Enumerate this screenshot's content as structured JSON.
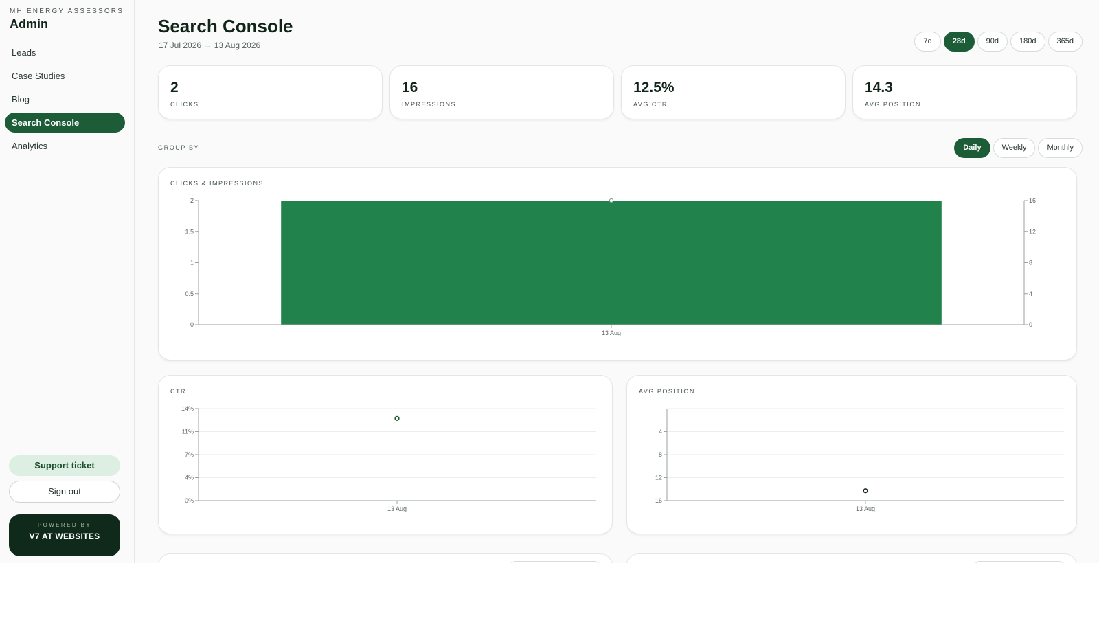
{
  "sidebar": {
    "kicker": "MH ENERGY ASSESSORS",
    "title": "Admin",
    "items": [
      {
        "label": "Leads",
        "active": false
      },
      {
        "label": "Case Studies",
        "active": false
      },
      {
        "label": "Blog",
        "active": false
      },
      {
        "label": "Search Console",
        "active": true
      },
      {
        "label": "Analytics",
        "active": false
      }
    ],
    "support_label": "Support ticket",
    "signout_label": "Sign out",
    "powered_kicker": "POWERED BY",
    "powered_name": "V7 AT WEBSITES"
  },
  "header": {
    "title": "Search Console",
    "date_range": "17 Jul 2026 → 13 Aug 2026",
    "ranges": [
      "7d",
      "28d",
      "90d",
      "180d",
      "365d"
    ],
    "active_range": "28d"
  },
  "stats": [
    {
      "value": "2",
      "label": "CLICKS"
    },
    {
      "value": "16",
      "label": "IMPRESSIONS"
    },
    {
      "value": "12.5%",
      "label": "AVG CTR"
    },
    {
      "value": "14.3",
      "label": "AVG POSITION"
    }
  ],
  "group_by": {
    "label": "GROUP BY",
    "options": [
      "Daily",
      "Weekly",
      "Monthly"
    ],
    "active": "Daily"
  },
  "colors": {
    "accent": "#1c5c37",
    "bar": "#21824c"
  },
  "chart_data": [
    {
      "type": "bar",
      "title": "CLICKS & IMPRESSIONS",
      "categories": [
        "13 Aug"
      ],
      "series": [
        {
          "axis": "left",
          "mark": "bar",
          "values": [
            2
          ]
        },
        {
          "axis": "right",
          "mark": "line",
          "values": [
            16
          ]
        }
      ],
      "ylim": [
        0,
        2
      ],
      "yticks": [
        "0",
        "0.5",
        "1",
        "1.5",
        "2"
      ],
      "y2lim": [
        0,
        16
      ],
      "y2ticks": [
        "0",
        "4",
        "8",
        "12",
        "16"
      ],
      "grid": false
    },
    {
      "type": "line",
      "title": "CTR",
      "categories": [
        "13 Aug"
      ],
      "values": [
        12.5
      ],
      "ylim": [
        0,
        14
      ],
      "yticks": [
        {
          "label": "0%",
          "value": 0
        },
        {
          "label": "4%",
          "value": 3.5
        },
        {
          "label": "7%",
          "value": 7
        },
        {
          "label": "11%",
          "value": 10.5
        },
        {
          "label": "14%",
          "value": 14
        }
      ],
      "grid": true
    },
    {
      "type": "line",
      "title": "AVG POSITION",
      "categories": [
        "13 Aug"
      ],
      "values": [
        14.3
      ],
      "ylim": [
        16,
        0
      ],
      "reversed": true,
      "yticks": [
        {
          "label": "4",
          "value": 4
        },
        {
          "label": "8",
          "value": 8
        },
        {
          "label": "12",
          "value": 12
        },
        {
          "label": "16",
          "value": 16
        }
      ],
      "grid": true
    }
  ]
}
